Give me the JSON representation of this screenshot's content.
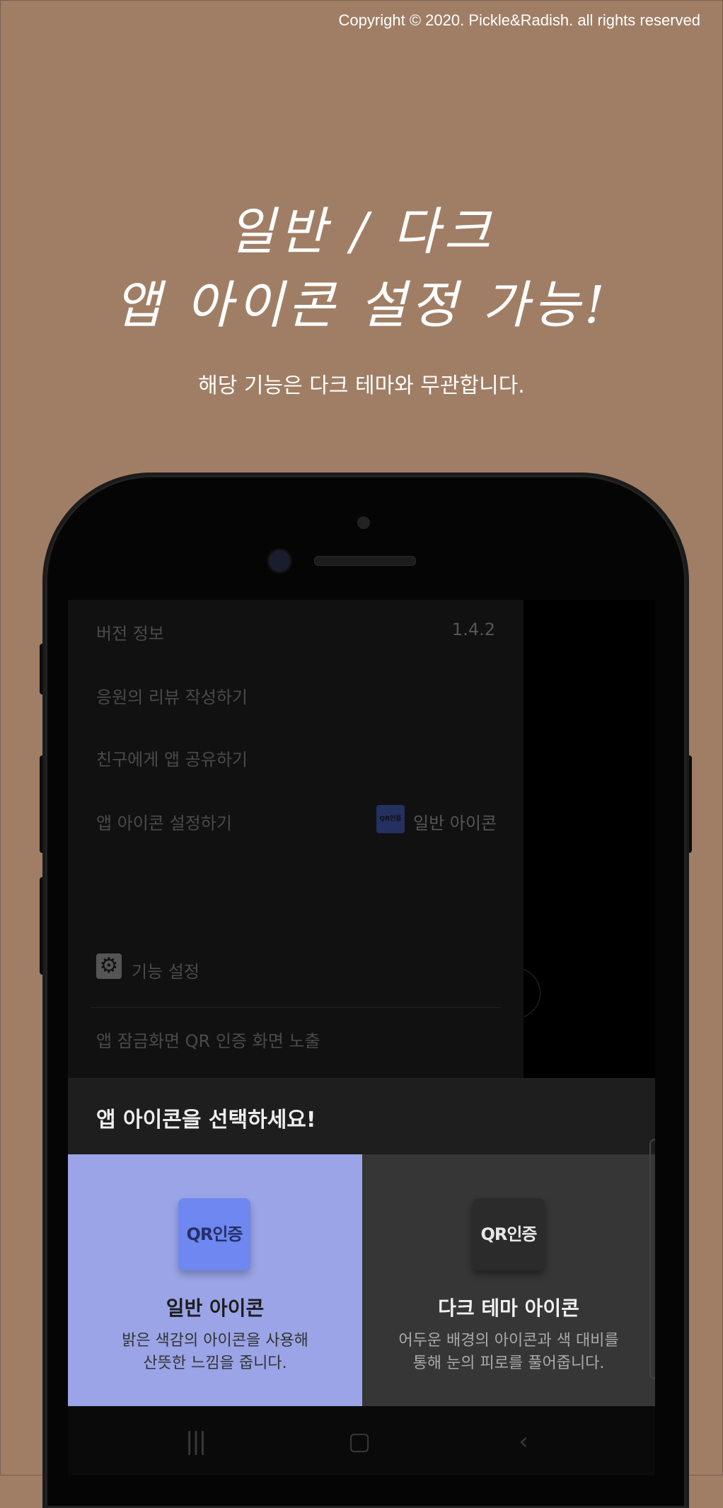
{
  "copyright": "Copyright © 2020. Pickle&Radish. all rights reserved",
  "headline": {
    "line1": "일반 / 다크",
    "line2": "앱 아이콘 설정 가능!"
  },
  "subtitle": "해당 기능은 다크 테마와 무관합니다.",
  "settings": {
    "version_label": "버전 정보",
    "version_value": "1.4.2",
    "review_label": "응원의 리뷰 작성하기",
    "share_label": "친구에게 앱 공유하기",
    "app_icon_label": "앱 아이콘 설정하기",
    "app_icon_mini_text": "QR인증",
    "app_icon_value": "일반 아이콘",
    "feature_section": "기능 설정",
    "lock_qr_label": "앱 잠금화면 QR 인증 화면 노출",
    "lock_qr_enabled": false
  },
  "sheet": {
    "title": "앱 아이콘을 선택하세요!",
    "options": [
      {
        "icon_text": "QR인증",
        "title": "일반 아이콘",
        "desc_line1": "밝은 색감의 아이콘을 사용해",
        "desc_line2": "산뜻한 느낌을 줍니다."
      },
      {
        "icon_text": "QR인증",
        "title": "다크 테마 아이콘",
        "desc_line1": "어두운 배경의 아이콘과 색 대비를",
        "desc_line2": "통해 눈의 피로를 풀어줍니다."
      }
    ]
  },
  "colors": {
    "background": "#a07e65",
    "light_option": "#9aa4e6",
    "dark_option": "#363636",
    "light_icon": "#6f87f0"
  },
  "icons": {
    "settings_section": "gear-icon",
    "nav": [
      "recent-apps-icon",
      "home-icon",
      "back-icon"
    ]
  }
}
